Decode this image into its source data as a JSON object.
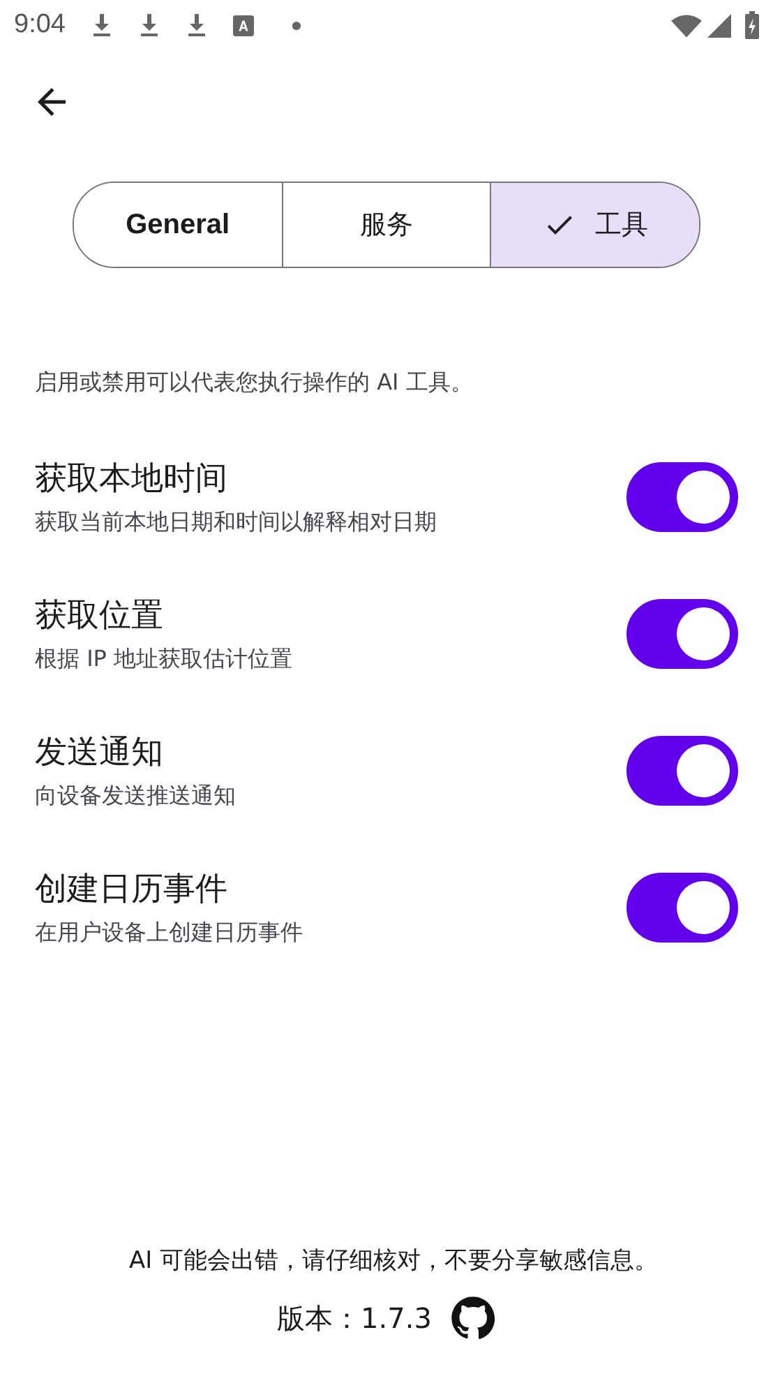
{
  "status_bar": {
    "time": "9:04"
  },
  "tabs": [
    {
      "label": "General",
      "selected": false
    },
    {
      "label": "服务",
      "selected": false
    },
    {
      "label": "工具",
      "selected": true
    }
  ],
  "description": "启用或禁用可以代表您执行操作的 AI 工具。",
  "tools": [
    {
      "title": "获取本地时间",
      "subtitle": "获取当前本地日期和时间以解释相对日期",
      "on": true
    },
    {
      "title": "获取位置",
      "subtitle": "根据 IP 地址获取估计位置",
      "on": true
    },
    {
      "title": "发送通知",
      "subtitle": "向设备发送推送通知",
      "on": true
    },
    {
      "title": "创建日历事件",
      "subtitle": "在用户设备上创建日历事件",
      "on": true
    }
  ],
  "footer": {
    "disclaimer": "AI 可能会出错，请仔细核对，不要分享敏感信息。",
    "version": "版本：1.7.3"
  }
}
